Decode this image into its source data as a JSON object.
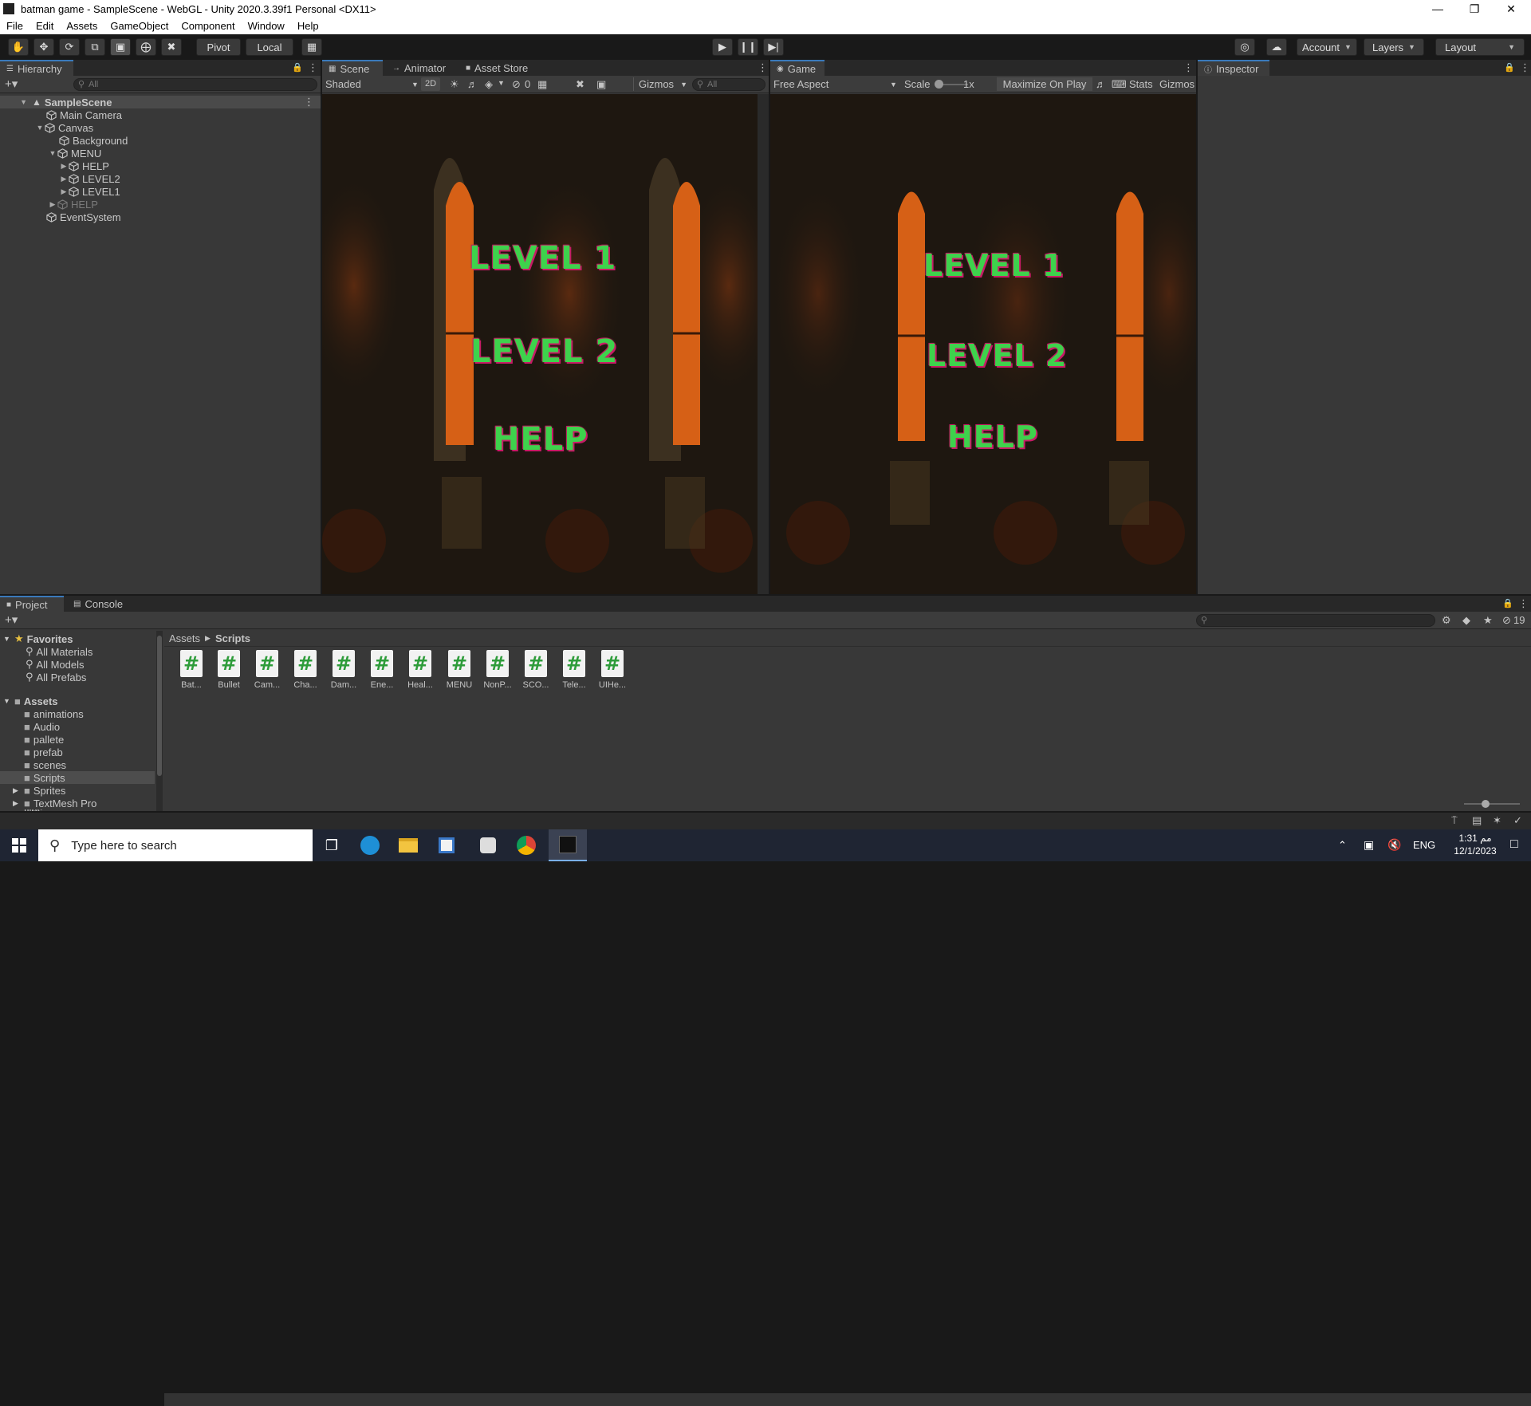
{
  "window": {
    "title": "batman game - SampleScene - WebGL - Unity 2020.3.39f1 Personal <DX11>"
  },
  "menu": [
    "File",
    "Edit",
    "Assets",
    "GameObject",
    "Component",
    "Window",
    "Help"
  ],
  "toolbar": {
    "pivot": "Pivot",
    "local": "Local",
    "account": "Account",
    "layers": "Layers",
    "layout": "Layout"
  },
  "hierarchy": {
    "tab": "Hierarchy",
    "search_placeholder": "All",
    "items": [
      {
        "label": "SampleScene",
        "depth": 0,
        "bold": true
      },
      {
        "label": "Main Camera",
        "depth": 1
      },
      {
        "label": "Canvas",
        "depth": 1
      },
      {
        "label": "Background",
        "depth": 2
      },
      {
        "label": "MENU",
        "depth": 2
      },
      {
        "label": "HELP",
        "depth": 3
      },
      {
        "label": "LEVEL2",
        "depth": 3
      },
      {
        "label": "LEVEL1",
        "depth": 3
      },
      {
        "label": "HELP",
        "depth": 2,
        "disabled": true
      },
      {
        "label": "EventSystem",
        "depth": 1
      }
    ]
  },
  "scene": {
    "tabs": [
      "Scene",
      "Animator",
      "Asset Store"
    ],
    "shading": "Shaded",
    "mode_2d": "2D",
    "hidden_count": "0",
    "gizmos": "Gizmos",
    "search_placeholder": "All"
  },
  "game": {
    "tab": "Game",
    "aspect": "Free Aspect",
    "scale_label": "Scale",
    "scale_value": "1x",
    "maximize": "Maximize On Play",
    "stats": "Stats",
    "gizmos": "Gizmos"
  },
  "ui_text": {
    "level1": "LEVEL 1",
    "level2": "LEVEL 2",
    "help": "HELP"
  },
  "inspector": {
    "tab": "Inspector"
  },
  "project": {
    "tabs": [
      "Project",
      "Console"
    ],
    "favorites_label": "Favorites",
    "favorites": [
      "All Materials",
      "All Models",
      "All Prefabs"
    ],
    "assets_label": "Assets",
    "folders": [
      "animations",
      "Audio",
      "pallete",
      "prefab",
      "scenes",
      "Scripts",
      "Sprites",
      "TextMesh Pro",
      "tiles"
    ],
    "breadcrumb": [
      "Assets",
      "Scripts"
    ],
    "hidden_count": "19",
    "scripts": [
      "Bat...",
      "Bullet",
      "Cam...",
      "Cha...",
      "Dam...",
      "Ene...",
      "Heal...",
      "MENU",
      "NonP...",
      "SCO...",
      "Tele...",
      "UIHe..."
    ]
  },
  "taskbar": {
    "search_placeholder": "Type here to search",
    "language": "ENG",
    "time": "1:31 مم",
    "date": "12/1/2023"
  }
}
